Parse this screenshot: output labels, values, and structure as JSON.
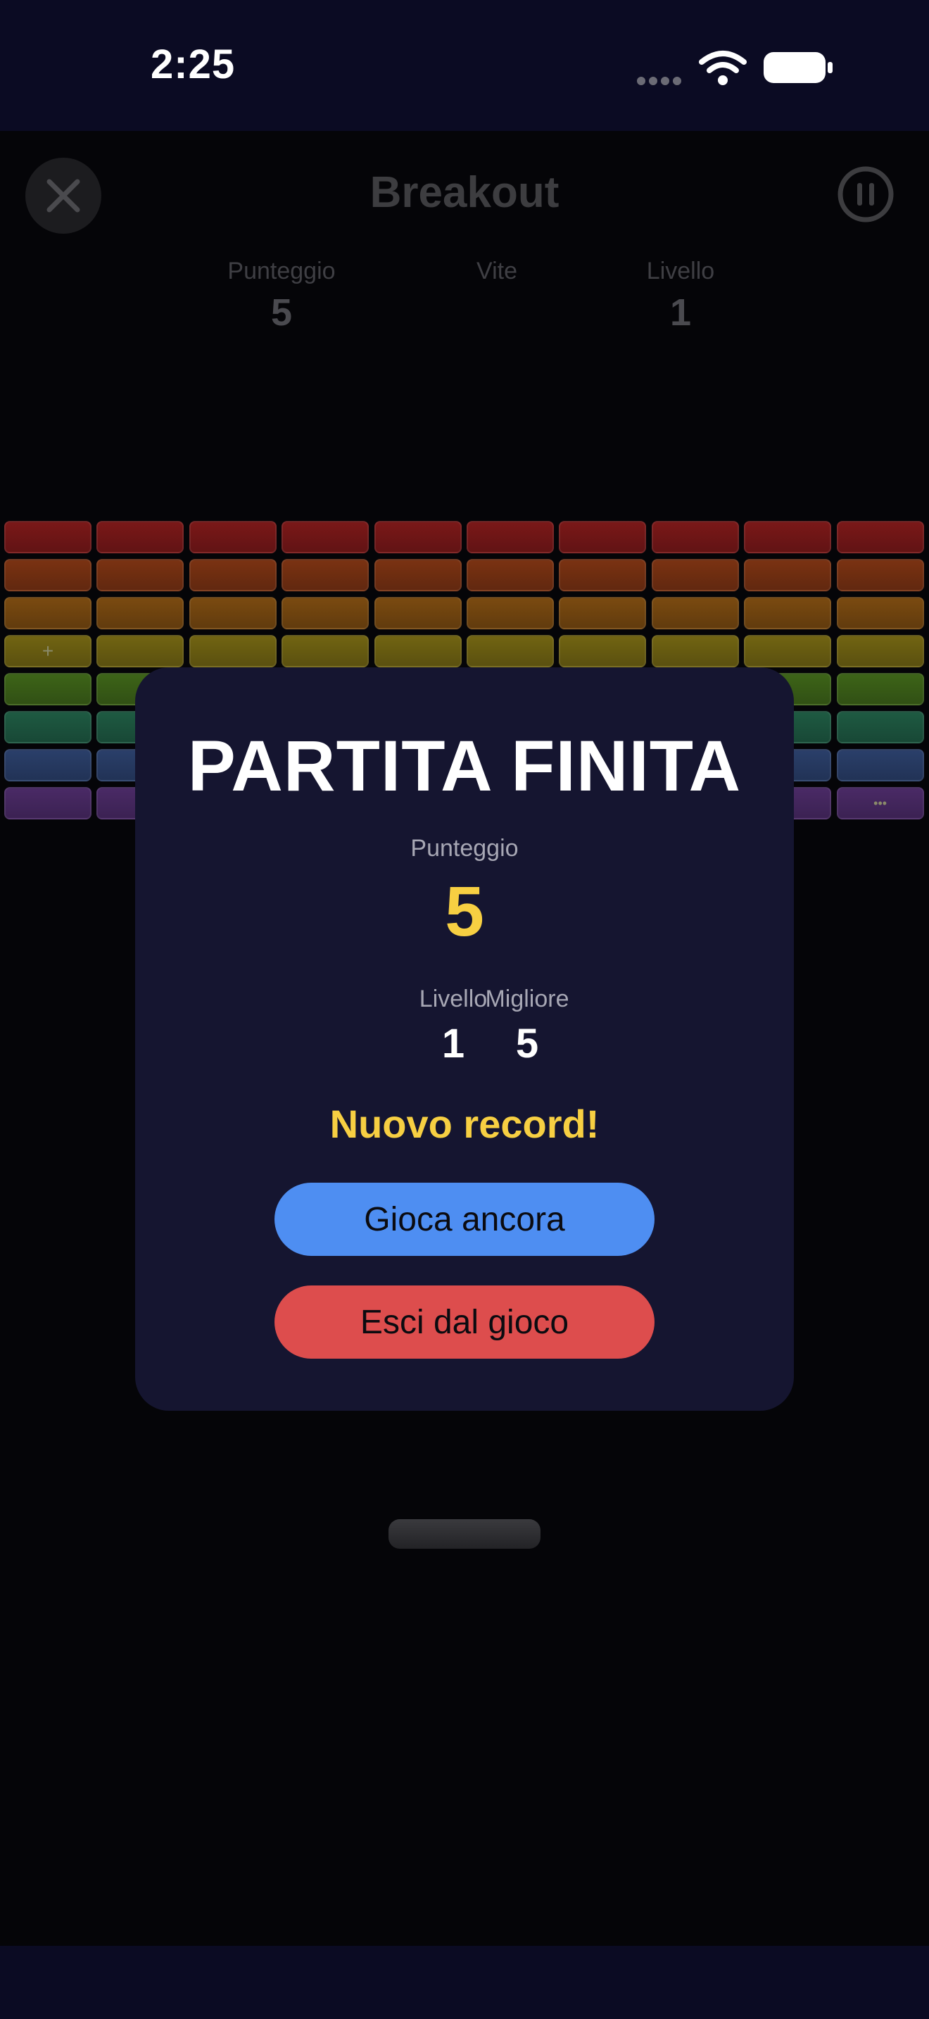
{
  "status_bar": {
    "time": "2:25"
  },
  "game": {
    "title": "Breakout",
    "stats": [
      {
        "label": "Punteggio",
        "value": "5"
      },
      {
        "label": "Vite",
        "value": ""
      },
      {
        "label": "Livello",
        "value": "1"
      }
    ],
    "brick_rows": [
      {
        "color": "#7a1818",
        "count": 10
      },
      {
        "color": "#7a3212",
        "count": 10
      },
      {
        "color": "#7a4a10",
        "count": 10
      },
      {
        "color": "#716412",
        "count": 10
      },
      {
        "color": "#3d6418",
        "count": 10
      },
      {
        "color": "#1e5a42",
        "count": 10
      },
      {
        "color": "#2a3f6a",
        "count": 10
      },
      {
        "color": "#4a2a66",
        "count": 10
      }
    ]
  },
  "game_over": {
    "title": "PARTITA FINITA",
    "score_label": "Punteggio",
    "score_value": "5",
    "level_label": "Livello",
    "level_value": "1",
    "best_label": "Migliore",
    "best_value": "5",
    "record_text": "Nuovo record!",
    "play_again_label": "Gioca ancora",
    "exit_label": "Esci dal gioco"
  },
  "colors": {
    "accent_yellow": "#f7cf42",
    "play_button": "#4e8ef2",
    "exit_button": "#dd4d4d",
    "modal_bg": "#151530"
  }
}
